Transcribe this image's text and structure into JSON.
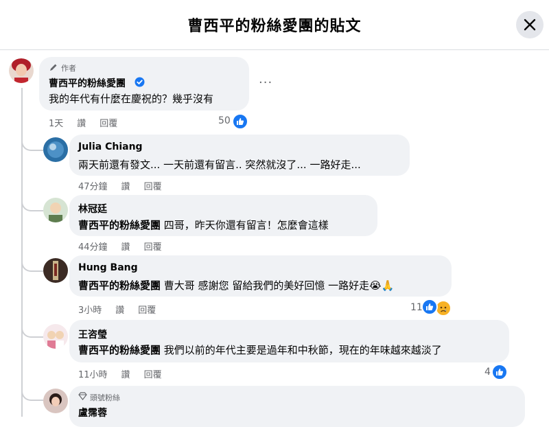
{
  "header": {
    "title": "曹西平的粉絲愛團的貼文"
  },
  "post": {
    "badge": "作者",
    "author": "曹西平的粉絲愛團",
    "text": "我的年代有什麼在慶祝的？幾乎沒有",
    "time": "1天",
    "like_label": "讚",
    "reply_label": "回覆",
    "reaction_count": "50",
    "more_label": "···"
  },
  "replies": [
    {
      "name": "Julia Chiang",
      "mention": "",
      "text": "兩天前還有發文... 一天前還有留言.. 突然就沒了... 一路好走...",
      "time": "47分鐘",
      "like_label": "讚",
      "reply_label": "回覆",
      "reaction_count": ""
    },
    {
      "name": "林冠廷",
      "mention": "曹西平的粉絲愛團",
      "text": " 四哥，昨天你還有留言！怎麼會這樣",
      "time": "44分鐘",
      "like_label": "讚",
      "reply_label": "回覆",
      "reaction_count": ""
    },
    {
      "name": "Hung Bang",
      "mention": "曹西平的粉絲愛團",
      "text": " 曹大哥 感謝您 留給我們的美好回憶 一路好走😭🙏",
      "time": "3小時",
      "like_label": "讚",
      "reply_label": "回覆",
      "reaction_count": "11"
    },
    {
      "name": "王咨瑩",
      "mention": "曹西平的粉絲愛團",
      "text": " 我們以前的年代主要是過年和中秋節，現在的年味越來越淡了",
      "time": "11小時",
      "like_label": "讚",
      "reply_label": "回覆",
      "reaction_count": "4"
    },
    {
      "badge": "頭號粉絲",
      "name": "盧霈蓉"
    }
  ],
  "colors": {
    "like_blue": "#1877f2",
    "verified_blue": "#1877f2",
    "bubble_bg": "#f0f2f5",
    "meta_gray": "#65676b"
  }
}
